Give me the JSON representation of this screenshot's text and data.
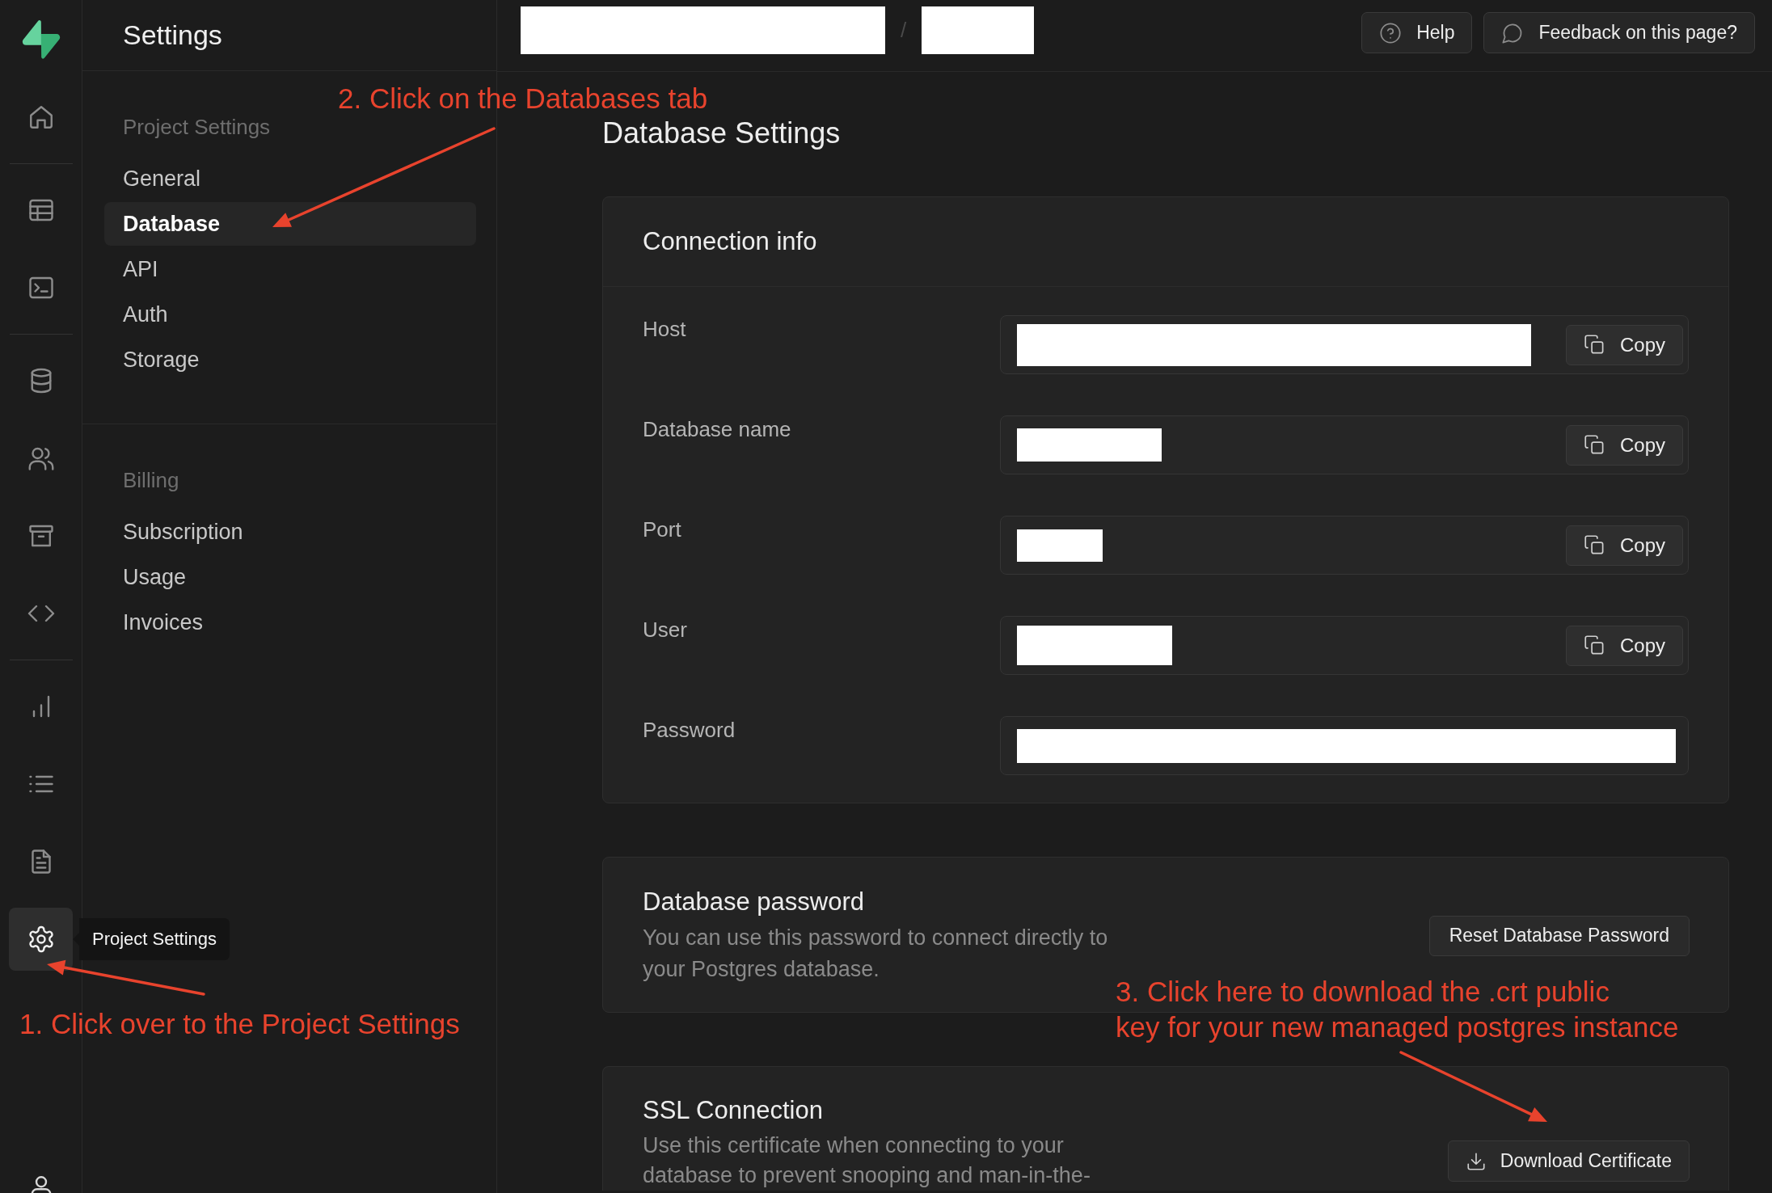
{
  "rail": {
    "groups": [
      [
        {
          "kind": "home",
          "selected": false
        }
      ],
      [
        {
          "kind": "table",
          "selected": false
        },
        {
          "kind": "terminal",
          "selected": false
        }
      ],
      [
        {
          "kind": "database",
          "selected": false
        },
        {
          "kind": "users",
          "selected": false
        },
        {
          "kind": "archive",
          "selected": false
        },
        {
          "kind": "code",
          "selected": false
        }
      ],
      [
        {
          "kind": "chart",
          "selected": false
        },
        {
          "kind": "list",
          "selected": false
        },
        {
          "kind": "document",
          "selected": false
        },
        {
          "kind": "settings",
          "selected": true,
          "tooltip": "Project Settings"
        }
      ]
    ],
    "footer": [
      {
        "kind": "user",
        "selected": false
      }
    ]
  },
  "sidebar": {
    "title": "Settings",
    "sections": [
      {
        "heading": "Project Settings",
        "items": [
          {
            "label": "General",
            "selected": false
          },
          {
            "label": "Database",
            "selected": true
          },
          {
            "label": "API",
            "selected": false
          },
          {
            "label": "Auth",
            "selected": false
          },
          {
            "label": "Storage",
            "selected": false
          }
        ]
      },
      {
        "heading": "Billing",
        "items": [
          {
            "label": "Subscription",
            "selected": false
          },
          {
            "label": "Usage",
            "selected": false
          },
          {
            "label": "Invoices",
            "selected": false
          }
        ]
      }
    ]
  },
  "topbar": {
    "breadcrumb": {
      "items": [
        {
          "redacted": true
        },
        {
          "redacted": true
        }
      ],
      "separator": "/"
    },
    "buttons": [
      {
        "kind": "help",
        "label": "Help"
      },
      {
        "kind": "feedback",
        "label": "Feedback on this page?"
      }
    ]
  },
  "page": {
    "title": "Database Settings"
  },
  "connection_info": {
    "title": "Connection info",
    "fields": [
      {
        "label": "Host",
        "redacted": true,
        "action": "Copy"
      },
      {
        "label": "Database name",
        "redacted": true,
        "action": "Copy"
      },
      {
        "label": "Port",
        "redacted": true,
        "action": "Copy"
      },
      {
        "label": "User",
        "redacted": true,
        "action": "Copy"
      },
      {
        "label": "Password",
        "redacted": true
      }
    ]
  },
  "database_password": {
    "title": "Database password",
    "description": "You can use this password to connect directly to your Postgres database.",
    "button": "Reset Database Password"
  },
  "ssl_connection": {
    "title": "SSL Connection",
    "description": "Use this certificate when connecting to your database to prevent snooping and man-in-the-",
    "button": "Download Certificate"
  },
  "annotations": [
    {
      "text": "2. Click on the Databases tab"
    },
    {
      "text": "1. Click over to the Project Settings"
    },
    {
      "text": "3. Click here to download the .crt public\nkey for your new managed postgres instance"
    }
  ]
}
